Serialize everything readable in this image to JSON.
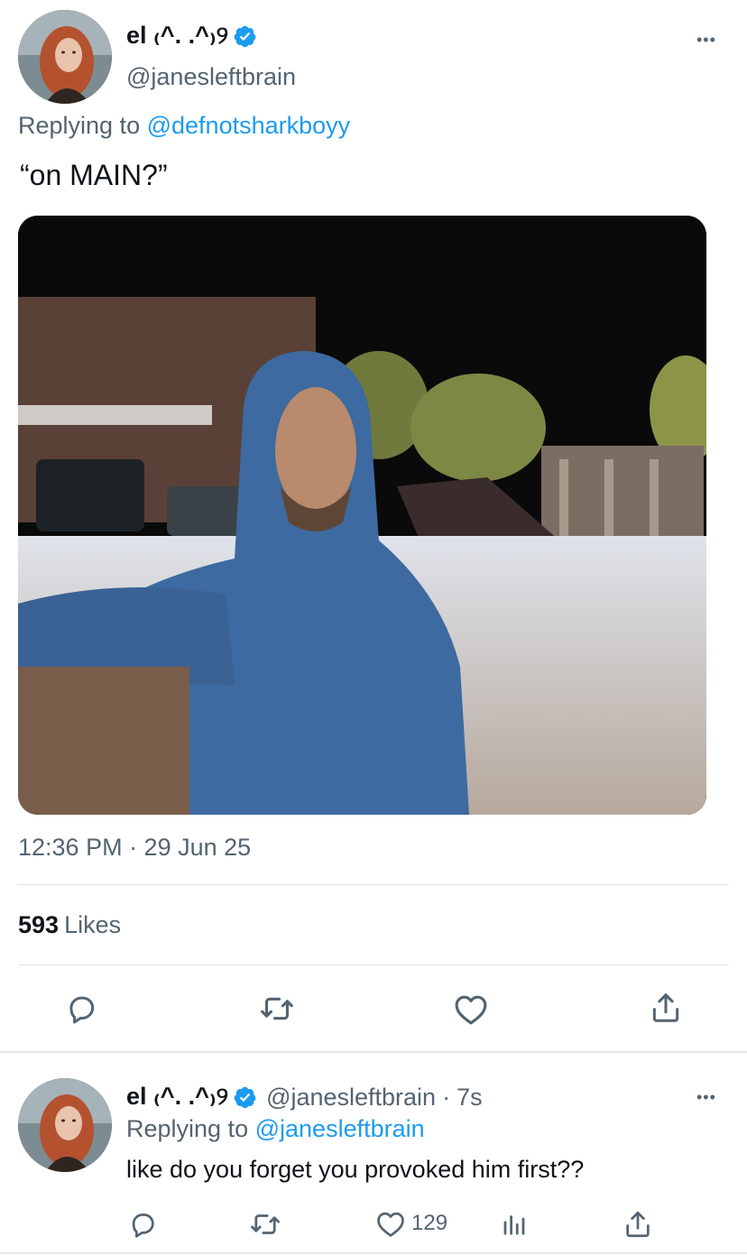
{
  "main_tweet": {
    "author": {
      "display_name": "el ₍^. .^₎୨",
      "handle": "@janesleftbrain",
      "verified": true
    },
    "replying_to_prefix": "Replying to",
    "replying_to_handle": "@defnotsharkboyy",
    "text": "“on MAIN?”",
    "media": {
      "description": "video still of a hooded man outdoors at night"
    },
    "timestamp": "12:36 PM · 29 Jun 25",
    "likes_count": "593",
    "likes_label": "Likes",
    "more_label": "•••",
    "actions": [
      "reply-icon",
      "retweet-icon",
      "like-icon",
      "share-icon"
    ]
  },
  "reply_tweet": {
    "author": {
      "display_name": "el ₍^. .^₎୨",
      "handle": "@janesleftbrain",
      "verified": true
    },
    "time_separator": "·",
    "time": "7s",
    "replying_to_prefix": "Replying to",
    "replying_to_handle": "@janesleftbrain",
    "text": "like do you forget you provoked him first??",
    "like_count": "129",
    "more_label": "•••",
    "actions": [
      "reply-icon",
      "retweet-icon",
      "like-icon",
      "analytics-icon",
      "share-icon"
    ]
  },
  "colors": {
    "accent": "#1d9bf0",
    "text_primary": "#0f1419",
    "text_secondary": "#536471",
    "divider": "#dfe3e6"
  }
}
